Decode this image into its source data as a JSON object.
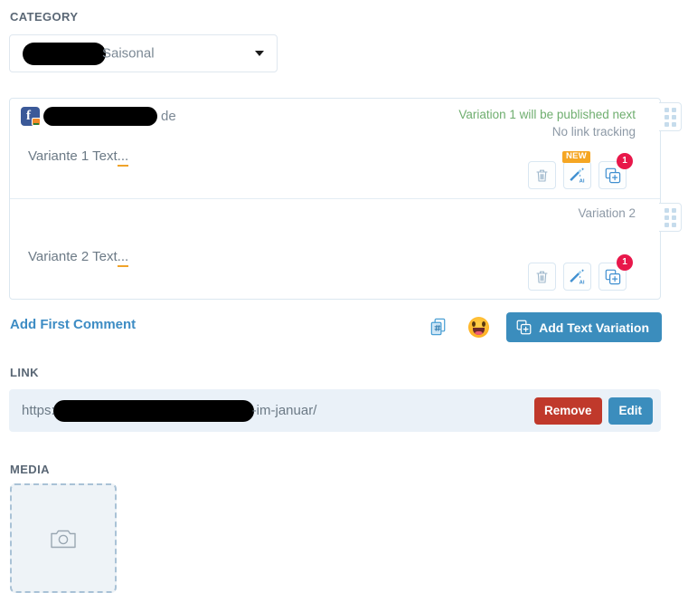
{
  "category": {
    "label": "CATEGORY",
    "selected_value": "Saisonal",
    "redacted": true,
    "caret_icon": "chevron-down-icon"
  },
  "variations": {
    "items": [
      {
        "network_icon": "facebook-icon",
        "account_name": "de",
        "account_redacted": true,
        "status_primary": "Variation 1 will be published next",
        "status_primary_number": "1",
        "status_secondary": "No link tracking",
        "text": "Variante 1 Text",
        "text_ellipsis": "...",
        "actions": {
          "delete_icon": "trash-icon",
          "ai_icon": "magic-wand-ai-icon",
          "ai_badge": "NEW",
          "duplicate_icon": "duplicate-add-icon",
          "duplicate_badge": "1"
        },
        "drag_handle_icon": "drag-handle-icon"
      },
      {
        "network_icon": null,
        "account_name": null,
        "status_primary": null,
        "status_secondary": null,
        "label": "Variation 2",
        "text": "Variante 2 Text",
        "text_ellipsis": "...",
        "actions": {
          "delete_icon": "trash-icon",
          "ai_icon": "magic-wand-ai-icon",
          "ai_badge": null,
          "duplicate_icon": "duplicate-add-icon",
          "duplicate_badge": "1"
        },
        "drag_handle_icon": "drag-handle-icon"
      }
    ]
  },
  "toolbar": {
    "add_comment_label": "Add First Comment",
    "hashtag_icon": "clipboard-hashtag-icon",
    "emoji_icon": "emoji-smiley-icon",
    "add_variation_label": "Add Text Variation",
    "add_variation_icon": "duplicate-add-icon"
  },
  "link": {
    "label": "LINK",
    "url_prefix": "https:",
    "url_suffix": "-im-januar/",
    "url_redacted": true,
    "remove_label": "Remove",
    "edit_label": "Edit"
  },
  "media": {
    "label": "MEDIA",
    "placeholder_icon": "camera-icon"
  },
  "colors": {
    "accent_blue": "#3b8dbd",
    "danger_red": "#c0392b",
    "badge_red": "#e8174a",
    "badge_orange": "#f5a623",
    "status_green": "#2e8b3a",
    "spellcheck_orange": "#f0a32a"
  }
}
